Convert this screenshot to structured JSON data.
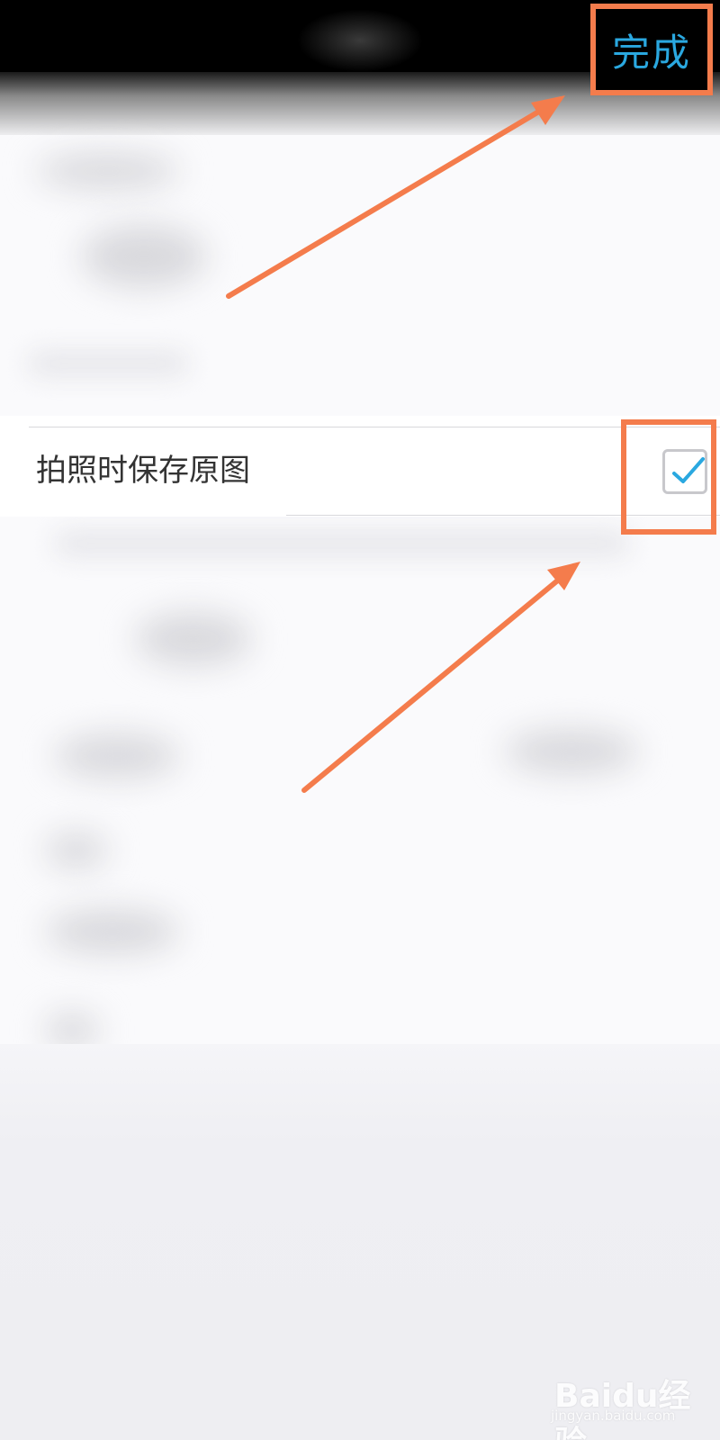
{
  "header": {
    "done_label": "完成"
  },
  "settings": {
    "save_original_label": "拍照时保存原图",
    "save_original_checked": true
  },
  "colors": {
    "accent": "#2aa8e0",
    "annotation": "#f47c4c",
    "label_text": "#333333"
  },
  "watermark": {
    "brand": "Baidu经验",
    "url": "jingyan.baidu.com"
  }
}
